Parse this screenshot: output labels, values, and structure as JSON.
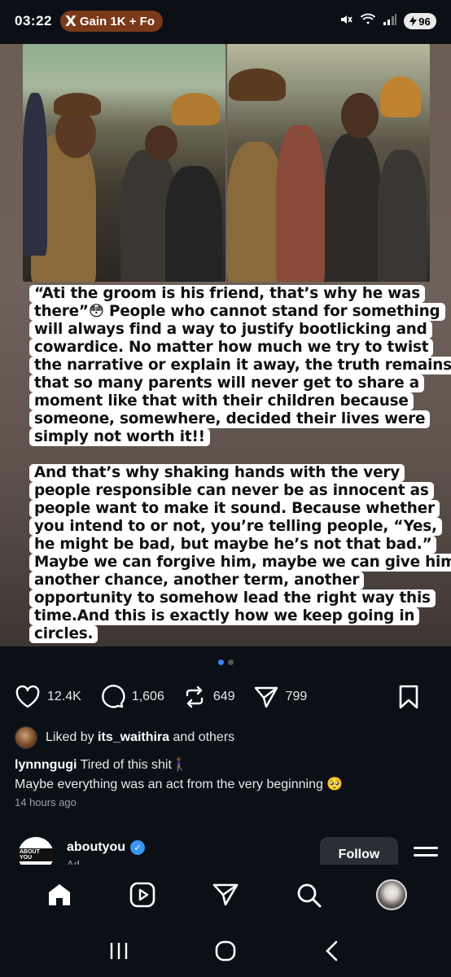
{
  "status_bar": {
    "time": "03:22",
    "pill_logo": "X",
    "pill_text": "Gain 1K + Fo",
    "icons": [
      "mute-icon",
      "wifi-icon",
      "signal-icon"
    ],
    "battery": "96"
  },
  "post": {
    "image_caption_lines": [
      "“Ati the groom is his friend, that’s why he was",
      "there”😳 People who cannot stand for something",
      "will always find a way to justify bootlicking and",
      "cowardice. No matter how much we try to twist",
      "the narrative or explain it away, the truth remains",
      "that so many parents will never get to share a",
      "moment like that with their children because",
      "someone, somewhere, decided their lives were",
      "simply not worth it!!"
    ],
    "image_caption_lines_2": [
      "And that’s why shaking hands with the very",
      "people responsible can never be as innocent as",
      "people want to make it sound. Because whether",
      "you intend to or not, you’re telling people, “Yes,",
      "he might be bad, but maybe he’s not that bad.”",
      "Maybe we can forgive him, maybe we can give him",
      "another chance, another term, another",
      "opportunity to somehow lead the right way this",
      "time.And this is exactly how we keep going in",
      "circles."
    ],
    "carousel": {
      "count": 2,
      "active_index": 0
    },
    "actions": {
      "likes": "12.4K",
      "comments": "1,606",
      "reposts": "649",
      "shares": "799"
    },
    "liked_by": {
      "prefix": "Liked by",
      "user": "its_waithira",
      "suffix": "and others"
    },
    "caption": {
      "username": "lynnngugi",
      "text_line1": "Tired of this shit🚶🏾‍♀️",
      "text_line2": "Maybe everything was an act from the very beginning 🥺"
    },
    "time_ago": "14 hours ago"
  },
  "next_post": {
    "avatar_text": "ABOUT YOU",
    "username": "aboutyou",
    "verified_mark": "✓",
    "subtitle": "Ad",
    "follow_label": "Follow"
  },
  "bottom_nav": [
    "home-icon",
    "reels-icon",
    "send-icon",
    "search-icon",
    "profile-avatar"
  ],
  "colors": {
    "background": "#0b0f16",
    "accent_blue": "#3b82f6",
    "verified_blue": "#3897f0",
    "pill_brown": "#7a3a1a"
  }
}
